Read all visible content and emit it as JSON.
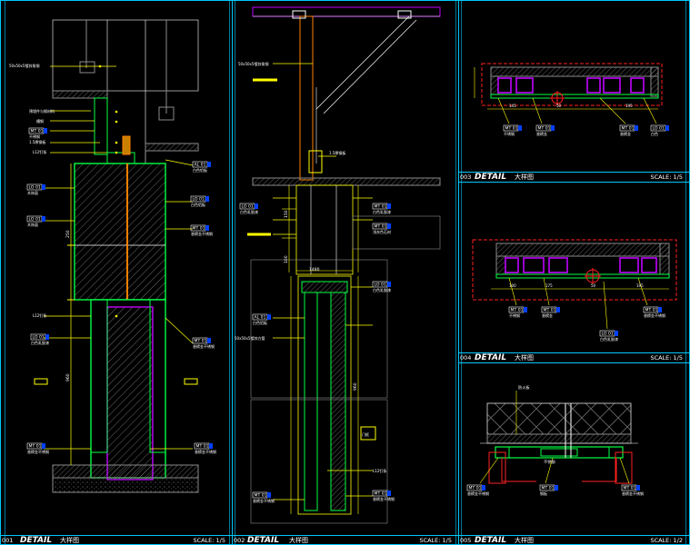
{
  "colors": {
    "background": "#000000",
    "frame": "#00c8ff",
    "yellow": "#ffff00",
    "green": "#00ff44",
    "magenta": "#c000ff",
    "red": "#ff2020",
    "white": "#ffffff",
    "grey": "#8a8a8a",
    "blue_tag": "#0040ff"
  },
  "panels": [
    {
      "id": "001",
      "title": "DETAIL",
      "subtitle": "大样图",
      "scale": "SCALE: 1/5"
    },
    {
      "id": "002",
      "title": "DETAIL",
      "subtitle": "大样图",
      "scale": "SCALE: 1/5"
    },
    {
      "id": "003",
      "title": "DETAIL",
      "subtitle": "大样图",
      "scale": "SCALE: 1/5"
    },
    {
      "id": "004",
      "title": "DETAIL",
      "subtitle": "大样图",
      "scale": "SCALE: 1/5"
    },
    {
      "id": "005",
      "title": "DETAIL",
      "subtitle": "大样图",
      "scale": "SCALE: 1/2"
    }
  ],
  "detail1": {
    "notes": [
      "50x50x5镀锌角钢",
      "预埋件与钢材料",
      "槽钢",
      "1.5厚钢板",
      "L12钉条",
      "L12钉条"
    ],
    "tags": [
      "MT 01",
      "LO 01",
      "AL 01",
      "LO 01",
      "LO 01",
      "MT 01",
      "LO 01",
      "MT 01"
    ],
    "tag_labels": [
      "不锈钢",
      "木饰面",
      "白色铝板",
      "白色铝板",
      "木饰面",
      "香槟金不锈钢",
      "白色乳胶漆",
      "香槟金不锈钢"
    ],
    "dims": [
      "250",
      "960"
    ]
  },
  "detail2": {
    "notes": [
      "50x50x5镀锌角钢",
      "1.5厚钢板",
      "50x50x5镀锌方管",
      "L12钉条",
      "门框"
    ],
    "tags": [
      "LO 01",
      "MT 01",
      "MT 01",
      "AL 01",
      "LO 01",
      "MT 01",
      "MT 01"
    ],
    "tag_labels": [
      "白色乳胶漆",
      "白色乳胶漆",
      "浅灰色石材",
      "白色铝板",
      "白色乳胶漆",
      "香槟金不锈钢",
      "香槟金不锈钢"
    ],
    "dims": [
      "150",
      "100",
      "1480",
      "960"
    ]
  },
  "detail3": {
    "tags": [
      "MT 01",
      "MT 01",
      "MT 01",
      "LO 01"
    ],
    "tag_labels": [
      "不锈钢",
      "香槟金",
      "香槟金",
      "白色"
    ],
    "dims": [
      "145",
      "50",
      "195"
    ]
  },
  "detail4": {
    "tags": [
      "MT 01",
      "MT 01",
      "LO 01",
      "MT 01"
    ],
    "tag_labels": [
      "不锈钢",
      "香槟金",
      "白色乳胶漆",
      "香槟金不锈钢"
    ],
    "dims": [
      "100",
      "175",
      "50",
      "195"
    ]
  },
  "detail5": {
    "note": "防火板",
    "center_label": "不锈钢",
    "tags": [
      "MT 01",
      "MT 01",
      "MT 01"
    ],
    "tag_labels": [
      "香槟金不锈钢",
      "钢板",
      "香槟金不锈钢"
    ]
  }
}
